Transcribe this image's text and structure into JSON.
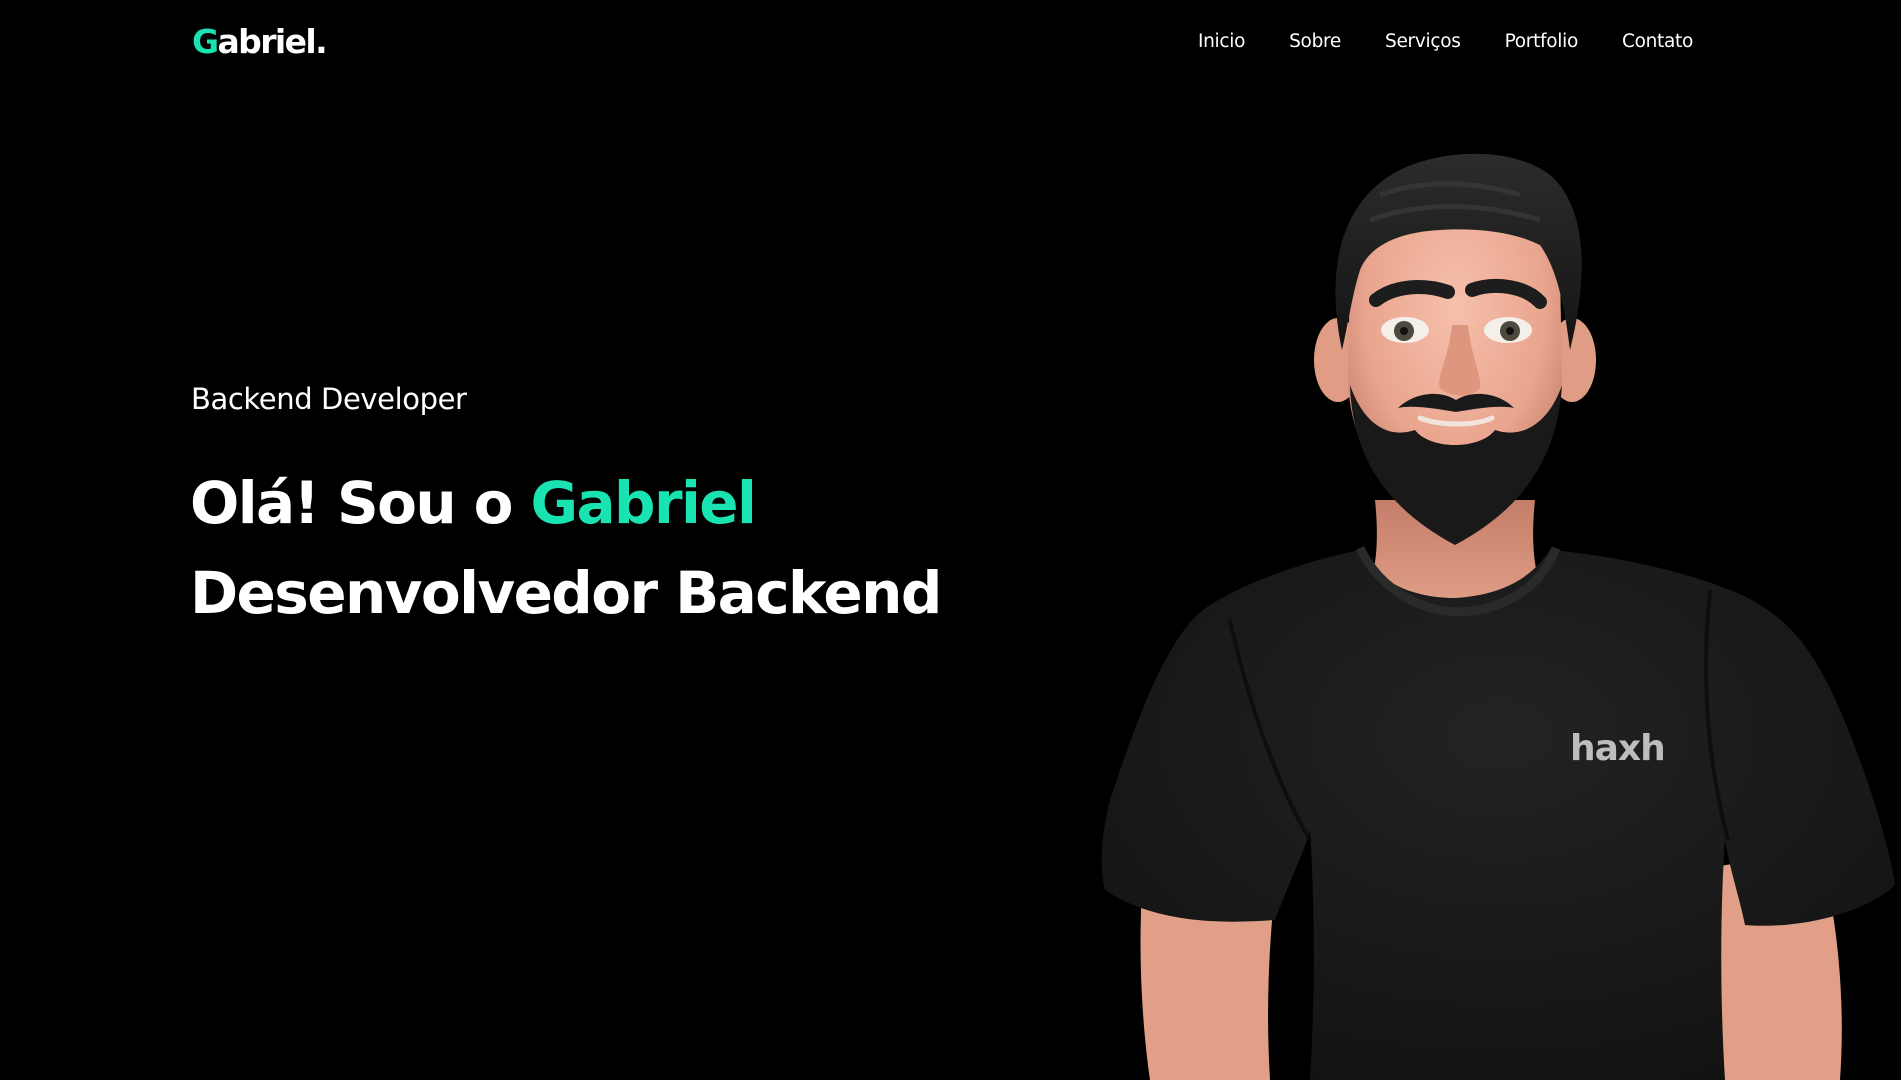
{
  "header": {
    "logo": {
      "initial": "G",
      "rest": "abriel."
    },
    "nav": [
      {
        "label": "Inicio"
      },
      {
        "label": "Sobre"
      },
      {
        "label": "Serviços"
      },
      {
        "label": "Portfolio"
      },
      {
        "label": "Contato"
      }
    ]
  },
  "hero": {
    "subtitle": "Backend Developer",
    "greeting": "Olá! Sou o",
    "name": "Gabriel",
    "role": "Desenvolvedor Backend"
  },
  "avatar": {
    "shirt_logo_text": "haxh"
  },
  "colors": {
    "accent": "#19e3b0",
    "background": "#000000",
    "text": "#ffffff"
  }
}
